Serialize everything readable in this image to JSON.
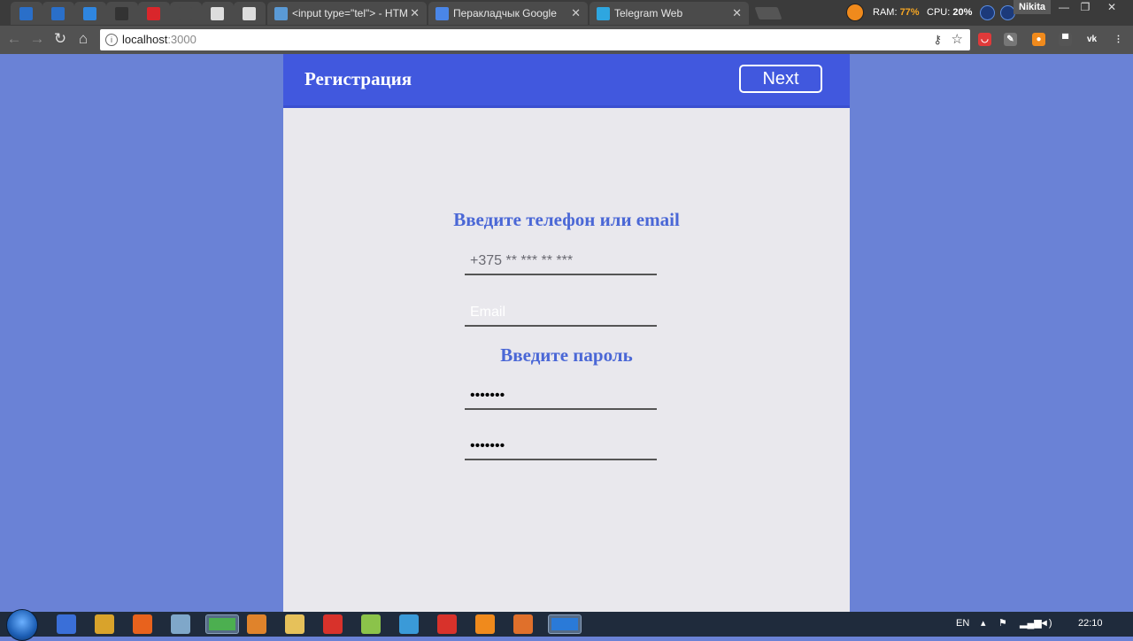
{
  "browser": {
    "tabs": [
      {
        "title": "",
        "icon": "page-icon",
        "color": "#2a6fc9"
      },
      {
        "title": "",
        "icon": "page-icon",
        "color": "#2a6fc9"
      },
      {
        "title": "",
        "icon": "flag-icon",
        "color": "#2f86e0"
      },
      {
        "title": "",
        "icon": "bolt-icon",
        "color": "#333333"
      },
      {
        "title": "",
        "icon": "app-icon",
        "color": "#d9262b"
      },
      {
        "title": "",
        "icon": "page-icon",
        "color": "#4b4b4b"
      },
      {
        "title": "",
        "icon": "doc-icon",
        "color": "#dddddd"
      },
      {
        "title": "",
        "icon": "doc-icon",
        "color": "#dddddd"
      },
      {
        "title": "<input type=\"tel\"> - HTML",
        "icon": "code-icon",
        "color": "#5a9ad6"
      },
      {
        "title": "Перакладчык Google",
        "icon": "translate-icon",
        "color": "#4a86e8"
      },
      {
        "title": "Telegram Web",
        "icon": "telegram-icon",
        "color": "#2ea6e0"
      }
    ],
    "close_glyph": "✕",
    "sysmon": {
      "ram_label": "RAM:",
      "ram_value": "77%",
      "cpu_label": "CPU:",
      "cpu_value": "20%"
    },
    "user_name": "Nikita",
    "window_buttons": {
      "minimize": "—",
      "maximize": "❐",
      "close": "✕"
    },
    "nav": {
      "back": "←",
      "forward": "→",
      "reload": "↻",
      "home": "⌂"
    },
    "url_host": "localhost",
    "url_port": ":3000",
    "omnibox_key": "⚷",
    "omnibox_star": "☆",
    "extensions": [
      {
        "icon": "pocket-icon",
        "color": "#e03a3a",
        "glyph": "◡"
      },
      {
        "icon": "pen-icon",
        "color": "#777777",
        "glyph": "✎"
      },
      {
        "icon": "orange-icon",
        "color": "#f08a1c",
        "glyph": "●"
      },
      {
        "icon": "brush-icon",
        "color": "#555555",
        "glyph": "▀"
      },
      {
        "icon": "vk-icon",
        "color": "#525252",
        "glyph": "vk"
      },
      {
        "icon": "menu-icon",
        "color": "#525252",
        "glyph": "⋮"
      }
    ]
  },
  "app": {
    "title": "Регистрация",
    "next_label": "Next",
    "contact_heading": "Введите телефон или email",
    "phone_placeholder": "+375 ** *** ** ***",
    "email_placeholder": "Email",
    "password_heading": "Введите пароль",
    "password_value": "1234567",
    "password_confirm_value": "1234567"
  },
  "taskbar": {
    "apps": [
      {
        "icon": "save-icon",
        "color": "#3a6fd8"
      },
      {
        "icon": "archive-icon",
        "color": "#d9a32b"
      },
      {
        "icon": "firefox-icon",
        "color": "#e8621d"
      },
      {
        "icon": "paint-icon",
        "color": "#7fa7c9"
      },
      {
        "icon": "chrome-icon",
        "color": "#4caf50"
      },
      {
        "icon": "sublime-icon",
        "color": "#e0832b"
      },
      {
        "icon": "folder-icon",
        "color": "#e6c15a"
      },
      {
        "icon": "colors-icon",
        "color": "#d8322b"
      },
      {
        "icon": "android-icon",
        "color": "#8bc34a"
      },
      {
        "icon": "window-icon",
        "color": "#3a9ad8"
      },
      {
        "icon": "record-icon",
        "color": "#d8322b"
      },
      {
        "icon": "orange-app-icon",
        "color": "#f08a1c"
      },
      {
        "icon": "orange-app2-icon",
        "color": "#e0702b"
      },
      {
        "icon": "vscode-icon",
        "color": "#2a7ad8"
      }
    ],
    "lang": "EN",
    "clock": "22:10"
  }
}
